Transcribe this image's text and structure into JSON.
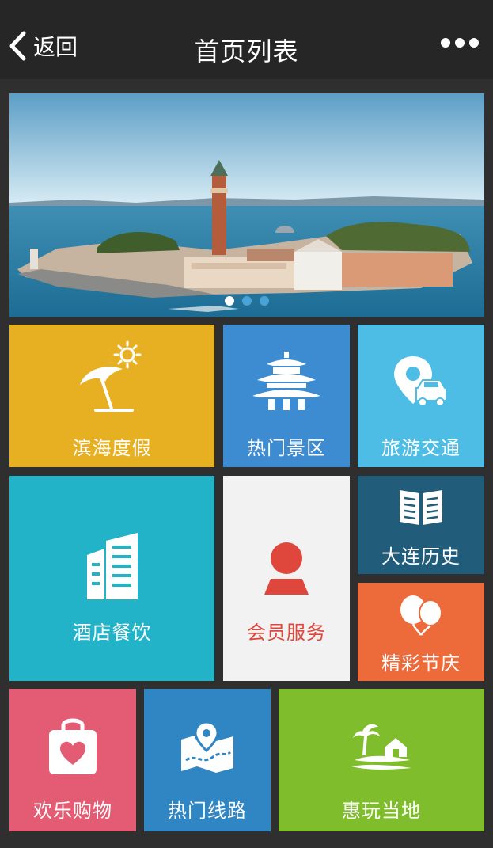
{
  "nav": {
    "back_label": "返回",
    "title": "首页列表"
  },
  "banner": {
    "slides": 3,
    "active_slide": 1
  },
  "tiles": [
    {
      "label": "滨海度假",
      "icon": "beach-umbrella-icon",
      "color": "#e7b023"
    },
    {
      "label": "热门景区",
      "icon": "pavilion-icon",
      "color": "#3d8bd1"
    },
    {
      "label": "旅游交通",
      "icon": "map-pin-car-icon",
      "color": "#4dbde6"
    },
    {
      "label": "酒店餐饮",
      "icon": "buildings-icon",
      "color": "#23b3c9"
    },
    {
      "label": "会员服务",
      "icon": "person-icon",
      "color": "#f2f2f2",
      "text_color": "#e0473c"
    },
    {
      "label": "大连历史",
      "icon": "open-book-icon",
      "color": "#215c7b"
    },
    {
      "label": "精彩节庆",
      "icon": "balloons-icon",
      "color": "#ed6a3b"
    },
    {
      "label": "欢乐购物",
      "icon": "shopping-bag-heart-icon",
      "color": "#e45c73"
    },
    {
      "label": "热门线路",
      "icon": "route-map-icon",
      "color": "#2f86c3"
    },
    {
      "label": "惠玩当地",
      "icon": "island-house-icon",
      "color": "#7fbd2c"
    }
  ]
}
